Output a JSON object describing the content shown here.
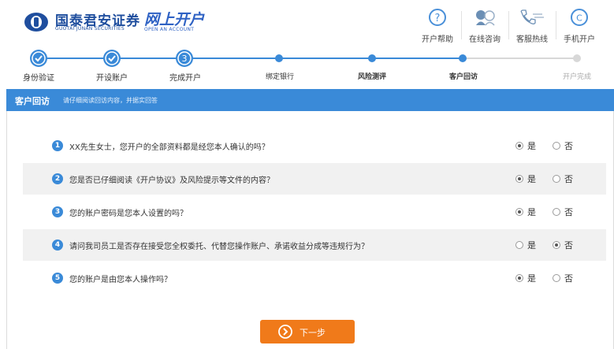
{
  "header": {
    "brand_cn": "国泰君安证券",
    "brand_en": "GUOTAI JUNAN SECURITIES",
    "open_cn": "网上开户",
    "open_en": "OPEN AN ACCOUNT",
    "tools": [
      {
        "label": "开户帮助",
        "icon": "help-icon"
      },
      {
        "label": "在线咨询",
        "icon": "chat-icon"
      },
      {
        "label": "客服热线",
        "icon": "phone-icon"
      },
      {
        "label": "手机开户",
        "icon": "mobile-icon"
      }
    ]
  },
  "progress": {
    "steps": [
      {
        "label": "身份验证",
        "state": "done"
      },
      {
        "label": "开设账户",
        "state": "done"
      },
      {
        "label": "完成开户",
        "state": "current",
        "number": "3"
      },
      {
        "label": "绑定银行",
        "state": "active"
      },
      {
        "label": "风险测评",
        "state": "active"
      },
      {
        "label": "客户回访",
        "state": "active"
      },
      {
        "label": "开户完成",
        "state": "todo"
      }
    ]
  },
  "banner": {
    "title": "客户回访",
    "subtitle": "请仔细阅读回访内容，并据实回答"
  },
  "questions": [
    {
      "num": "1",
      "text": "XX先生女士，您开户的全部资料都是经您本人确认的吗？",
      "answer": "yes"
    },
    {
      "num": "2",
      "text": "您是否已仔细阅读《开户协议》及风险提示等文件的内容？",
      "answer": "yes"
    },
    {
      "num": "3",
      "text": "您的账户密码是您本人设置的吗？",
      "answer": "yes"
    },
    {
      "num": "4",
      "text": "请问我司员工是否存在接受您全权委托、代替您操作账户、承诺收益分成等违规行为？",
      "answer": "no"
    },
    {
      "num": "5",
      "text": "您的账户是由您本人操作吗？",
      "answer": "yes"
    }
  ],
  "options": {
    "yes": "是",
    "no": "否"
  },
  "next_button": {
    "label": "下一步"
  },
  "colors": {
    "primary": "#3a8ad8",
    "brand": "#1f4e9e",
    "accent": "#f07a1a",
    "row_alt": "#f1f1f1"
  }
}
